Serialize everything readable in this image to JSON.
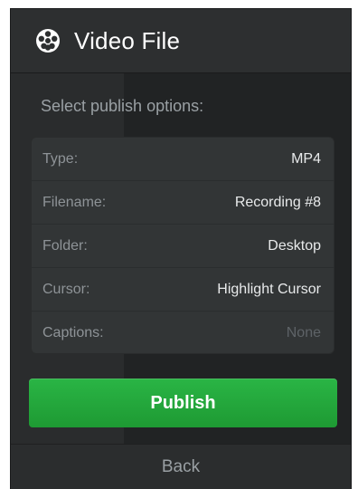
{
  "header": {
    "title": "Video File",
    "icon": "film-reel-icon"
  },
  "subtitle": "Select publish options:",
  "options": [
    {
      "key": "Type:",
      "value": "MP4"
    },
    {
      "key": "Filename:",
      "value": "Recording #8"
    },
    {
      "key": "Folder:",
      "value": "Desktop"
    },
    {
      "key": "Cursor:",
      "value": "Highlight Cursor"
    },
    {
      "key": "Captions:",
      "value": "None"
    }
  ],
  "actions": {
    "publish_label": "Publish",
    "back_label": "Back"
  },
  "colors": {
    "publish": "#22a83b",
    "panel": "#2a2c2d"
  }
}
